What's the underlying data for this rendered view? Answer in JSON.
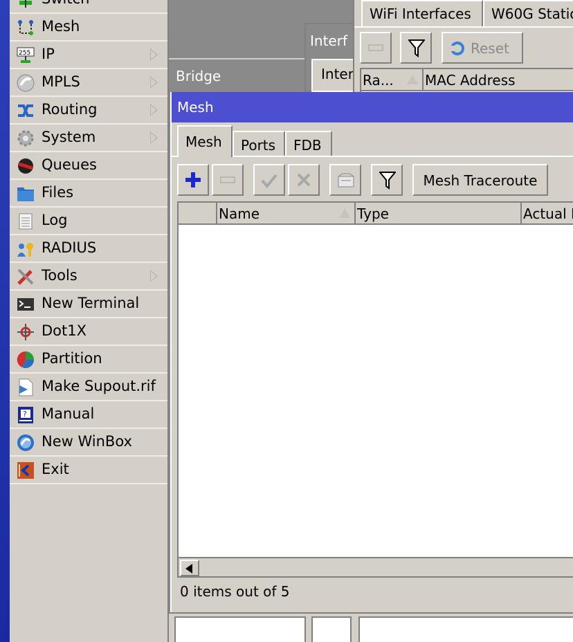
{
  "sidebar": {
    "items": [
      {
        "label": "Switch",
        "icon": "switch-icon",
        "submenu": false
      },
      {
        "label": "Mesh",
        "icon": "mesh-icon",
        "submenu": false
      },
      {
        "label": "IP",
        "icon": "ip-icon",
        "submenu": true
      },
      {
        "label": "MPLS",
        "icon": "mpls-icon",
        "submenu": true
      },
      {
        "label": "Routing",
        "icon": "routing-icon",
        "submenu": true
      },
      {
        "label": "System",
        "icon": "system-gear-icon",
        "submenu": true
      },
      {
        "label": "Queues",
        "icon": "queues-icon",
        "submenu": false
      },
      {
        "label": "Files",
        "icon": "folder-icon",
        "submenu": false
      },
      {
        "label": "Log",
        "icon": "log-icon",
        "submenu": false
      },
      {
        "label": "RADIUS",
        "icon": "radius-icon",
        "submenu": false
      },
      {
        "label": "Tools",
        "icon": "tools-icon",
        "submenu": true
      },
      {
        "label": "New Terminal",
        "icon": "terminal-icon",
        "submenu": false
      },
      {
        "label": "Dot1X",
        "icon": "dot1x-icon",
        "submenu": false
      },
      {
        "label": "Partition",
        "icon": "partition-icon",
        "submenu": false
      },
      {
        "label": "Make Supout.rif",
        "icon": "supout-icon",
        "submenu": false
      },
      {
        "label": "Manual",
        "icon": "manual-icon",
        "submenu": false
      },
      {
        "label": "New WinBox",
        "icon": "winbox-icon",
        "submenu": false
      },
      {
        "label": "Exit",
        "icon": "exit-icon",
        "submenu": false
      }
    ]
  },
  "background_windows": {
    "interfaces_title": "Interf",
    "interfaces_tab": "Inter",
    "bridge_title": "Bridge"
  },
  "wifi_window": {
    "tabs": [
      "WiFi Interfaces",
      "W60G Statio"
    ],
    "reset_label": "Reset",
    "columns": [
      "Ra...",
      "MAC Address"
    ]
  },
  "mesh_window": {
    "title": "Mesh",
    "tabs": [
      "Mesh",
      "Ports",
      "FDB"
    ],
    "traceroute_label": "Mesh Traceroute",
    "columns": [
      "Name",
      "Type",
      "Actual M"
    ],
    "status": "0 items out of 5"
  },
  "colors": {
    "title_bar": "#4b4fd0",
    "window_bg": "#d4d0c8",
    "accent_blue": "#1b2aa0"
  }
}
